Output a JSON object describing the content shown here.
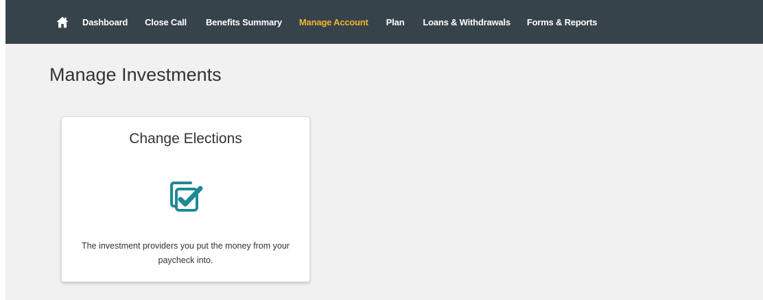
{
  "nav": {
    "home_icon": "home-icon",
    "items": [
      {
        "label": "Dashboard",
        "active": false
      },
      {
        "label": "Close Call",
        "active": false
      },
      {
        "label": "Benefits Summary",
        "active": false
      },
      {
        "label": "Manage Account",
        "active": true
      },
      {
        "label": "Plan",
        "active": false
      },
      {
        "label": "Loans & Withdrawals",
        "active": false
      },
      {
        "label": "Forms & Reports",
        "active": false
      }
    ]
  },
  "page": {
    "title": "Manage Investments"
  },
  "card": {
    "title": "Change Elections",
    "icon": "stacked-checkbox-icon",
    "description": "The investment providers you put the money from your paycheck into."
  },
  "colors": {
    "nav_background": "#37434b",
    "nav_text": "#ffffff",
    "nav_active": "#f3b432",
    "page_background": "#f1f1f1",
    "icon_teal": "#1f8a94",
    "card_background": "#ffffff"
  }
}
